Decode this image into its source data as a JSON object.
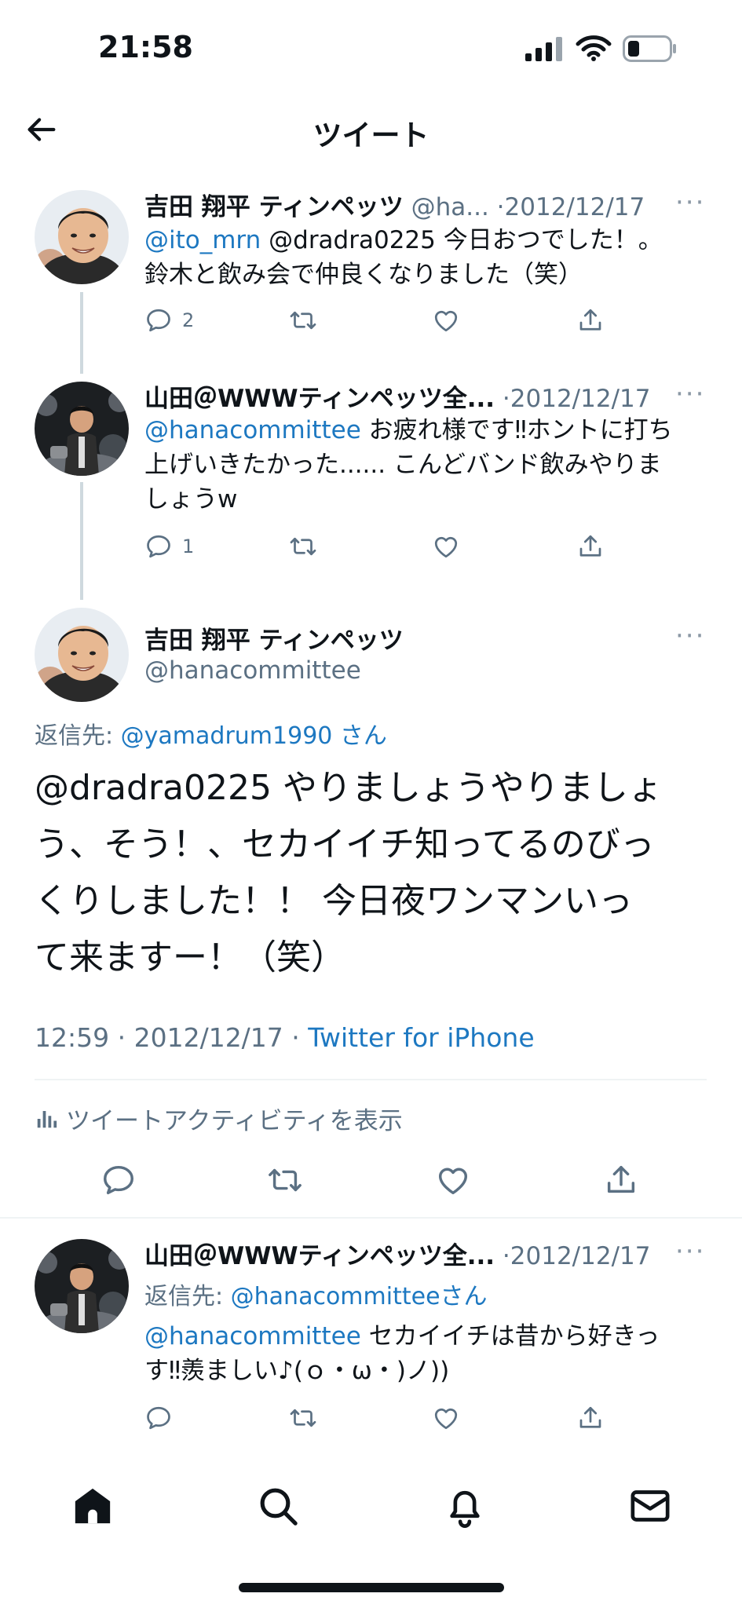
{
  "status_bar": {
    "time": "21:58"
  },
  "header": {
    "title": "ツイート"
  },
  "tweets": [
    {
      "name": "吉田 翔平 ティンペッツ",
      "handle": "@ha...",
      "sep": "·",
      "date": "2012/12/17",
      "mention": "@ito_mrn",
      "text1": " @dradra0225 今日おつでした！。",
      "text2": "鈴木と飲み会で仲良くなりました（笑）",
      "reply_count": "2"
    },
    {
      "name": "山田＠WWWティンペッツ全...",
      "sep": "·",
      "date": "2012/12/17",
      "mention": "@hanacommittee",
      "text1": " お疲れ様です‼ホントに打ち",
      "text2": "上げいきたかった...... こんどバンド飲みやりま",
      "text3": "しょうw",
      "reply_count": "1"
    }
  ],
  "main_tweet": {
    "name": "吉田 翔平 ティンペッツ",
    "handle": "@hanacommittee",
    "reply_to_label": "返信先: ",
    "reply_to_handle": "@yamadrum1990",
    "reply_to_suffix": " さん",
    "text_line1": "@dradra0225 やりましょうやりましょ",
    "text_line2": "う、そう！、セカイイチ知ってるのびっ",
    "text_line3": "くりしました！！ 今日夜ワンマンいっ",
    "text_line4": "て来ますー！（笑）",
    "time": "12:59",
    "date": "2012/12/17",
    "sep": " · ",
    "source": "Twitter for iPhone",
    "activity": "ツイートアクティビティを表示"
  },
  "reply_tweet": {
    "name": "山田＠WWWティンペッツ全...",
    "sep": "·",
    "date": "2012/12/17",
    "reply_to_label": "返信先: ",
    "reply_to_handle": "@hanacommitteeさん",
    "mention": "@hanacommittee",
    "text1": " セカイイチは昔から好きっ",
    "text2": "す‼羨ましい♪(ｏ・ω・)ノ))"
  },
  "icons": [
    "back-arrow-icon",
    "reply-icon",
    "retweet-icon",
    "like-icon",
    "share-icon",
    "home-icon",
    "search-icon",
    "notifications-icon",
    "messages-icon",
    "activity-bars-icon",
    "more-icon"
  ],
  "colors": {
    "link": "#1d78c1",
    "secondary_text": "#5b7083",
    "divider": "#eff3f4"
  }
}
